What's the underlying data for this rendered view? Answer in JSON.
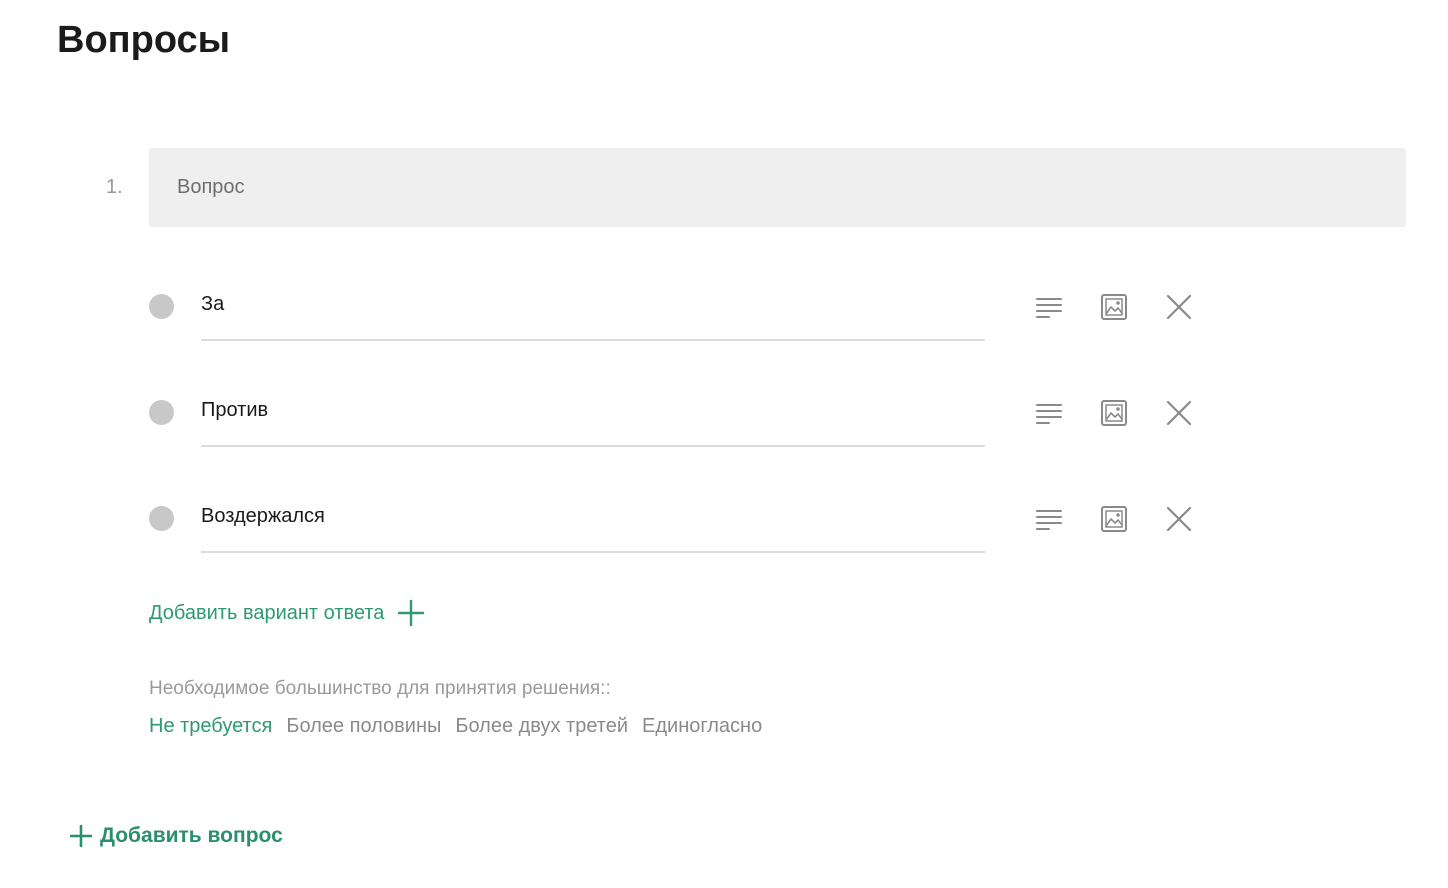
{
  "page": {
    "title": "Вопросы"
  },
  "question": {
    "number": "1.",
    "placeholder": "Вопрос",
    "value": ""
  },
  "options": [
    {
      "value": "За"
    },
    {
      "value": "Против"
    },
    {
      "value": "Воздержался"
    }
  ],
  "icons": {
    "description": "description-lines-icon",
    "image": "image-icon",
    "remove": "close-icon",
    "plus": "plus-icon"
  },
  "add_option": {
    "label": "Добавить вариант ответа"
  },
  "majority": {
    "label": "Необходимое большинство для принятия решения::",
    "options": [
      "Не требуется",
      "Более половины",
      "Более двух третей",
      "Единогласно"
    ],
    "selected": "Не требуется"
  },
  "add_question": {
    "label": "Добавить вопрос"
  },
  "colors": {
    "accent": "#2e9a70",
    "muted": "#8a8a8a",
    "field_bg": "#efefef",
    "radio": "#c8c8c8"
  }
}
